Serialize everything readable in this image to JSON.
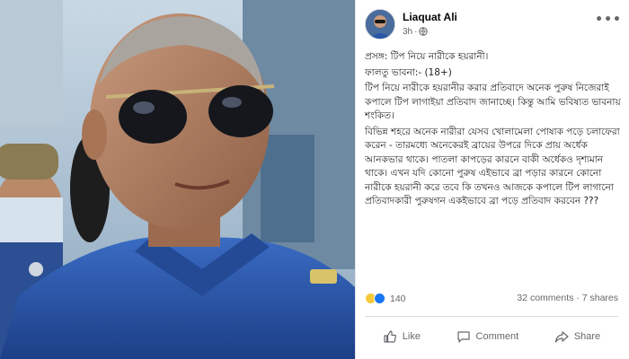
{
  "post": {
    "author": "Liaquat Ali",
    "time": "3h",
    "separator": "·",
    "more_label": "•••",
    "lines": [
      "প্রসঙ্গ: টিপ নিয়ে নারীকে হয়রানী।",
      "ফালতু ভাবনা:-  (18+)",
      " টিপ নিয়ে নারীকে হয়রানীর করার প্রতিবাদে অনেক পুরুষ নিজেরাই কপালে টিপ লাগাইয়া প্রতিবাদ জানাচ্ছে। কিন্তু আমি ভবিষ্যত ভাবনায় শংকিত।",
      "বিভিন্ন শহরে অনেক নারীরা যেসব খোলামেলা পোষাক পড়ে চলাফেরা করেন - তারমধ্যে অনেকেরই ব্রায়ের উপরে দিকে প্রায় অর্ধেক আনকভার থাকে। পাতলা কাপড়ের কারনে বাকী অর্ধেকও দৃশ্যমান থাকে। এখন যদি কোনো পুরুষ এইভাবে ব্রা পড়ার কারনে কোনো নারীকে হয়রানী করে তবে কি তখনও আজকে কপালে টিপ লাগানো প্রতিবাদকারী পুরুষগন একইভাবে ব্রা পড়ে প্রতিবাদ করবেন ???"
    ],
    "reaction_count": "140",
    "comments": "32 comments",
    "shares": "7 shares",
    "like_label": "Like",
    "comment_label": "Comment",
    "share_label": "Share"
  },
  "colors": {
    "uniform_blue": "#2a56a8",
    "text_secondary": "#65676b",
    "like_blue": "#1877f2",
    "haha_yellow": "#f7c93a"
  }
}
